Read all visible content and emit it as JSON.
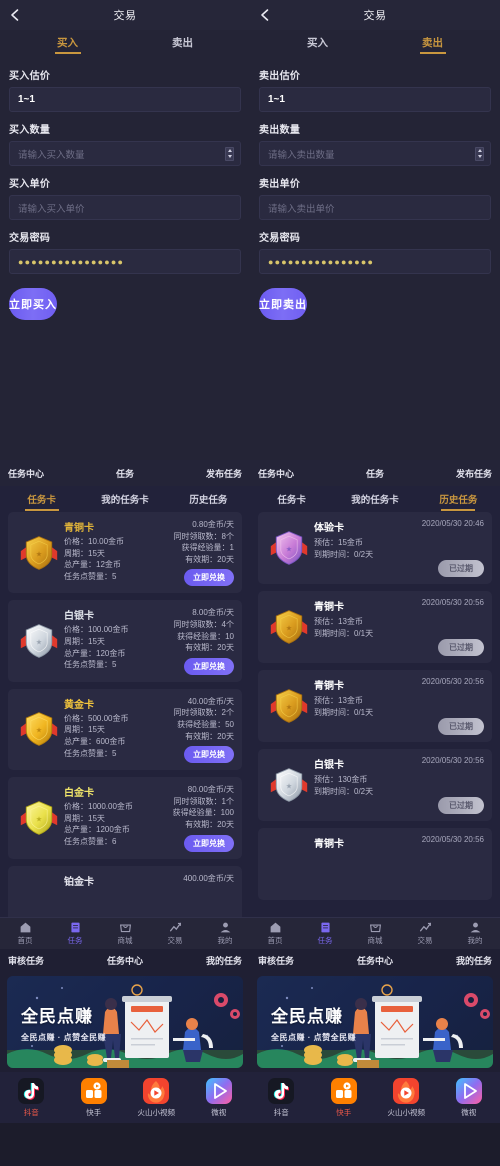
{
  "theme": {
    "bg": "#1c1c2b",
    "panel": "#242436",
    "card": "#2a2a42",
    "accent_gold": "#c9973f",
    "accent_purple": "#6b5bf0",
    "text_primary": "#ffffff",
    "text_secondary": "#b9b9cc",
    "highlight_red": "#f05a4a"
  },
  "trade": {
    "left": {
      "title": "交易",
      "back_icon": "chevron-left-icon",
      "tabs": [
        {
          "label": "买入",
          "active": true
        },
        {
          "label": "卖出",
          "active": false
        }
      ],
      "fields": [
        {
          "label": "买入估价",
          "value": "1~1",
          "placeholder": "",
          "type": "static"
        },
        {
          "label": "买入数量",
          "value": "",
          "placeholder": "请输入买入数量",
          "type": "number"
        },
        {
          "label": "买入单价",
          "value": "",
          "placeholder": "请输入买入单价",
          "type": "text"
        },
        {
          "label": "交易密码",
          "value": "●●●●●●●●●●●●●●●●",
          "placeholder": "",
          "type": "password"
        }
      ],
      "cta": "立即买入"
    },
    "right": {
      "title": "交易",
      "back_icon": "chevron-left-icon",
      "tabs": [
        {
          "label": "买入",
          "active": false
        },
        {
          "label": "卖出",
          "active": true
        }
      ],
      "fields": [
        {
          "label": "卖出估价",
          "value": "1~1",
          "placeholder": "",
          "type": "static"
        },
        {
          "label": "卖出数量",
          "value": "",
          "placeholder": "请输入卖出数量",
          "type": "number"
        },
        {
          "label": "卖出单价",
          "value": "",
          "placeholder": "请输入卖出单价",
          "type": "text"
        },
        {
          "label": "交易密码",
          "value": "●●●●●●●●●●●●●●●●",
          "placeholder": "",
          "type": "password"
        }
      ],
      "cta": "立即卖出"
    }
  },
  "task": {
    "header": {
      "left": "任务中心",
      "mid": "任务",
      "right": "发布任务"
    },
    "left": {
      "tabs": [
        {
          "label": "任务卡",
          "active": true
        },
        {
          "label": "我的任务卡",
          "active": false
        },
        {
          "label": "历史任务",
          "active": false
        }
      ],
      "cards": [
        {
          "name": "青铜卡",
          "color": "#e0b43a",
          "medal": "bronze",
          "left_lines": [
            "价格：10.00金币",
            "周期：15天",
            "总产量：12金币",
            "任务点赞量：5"
          ],
          "right_lines": [
            "0.80金币/天",
            "同时领取数：8个",
            "获得经验量：1",
            "有效期：20天"
          ],
          "button": "立即兑换"
        },
        {
          "name": "白银卡",
          "color": "#dfe3ea",
          "medal": "silver",
          "left_lines": [
            "价格：100.00金币",
            "周期：15天",
            "总产量：120金币",
            "任务点赞量：5"
          ],
          "right_lines": [
            "8.00金币/天",
            "同时领取数：4个",
            "获得经验量：10",
            "有效期：20天"
          ],
          "button": "立即兑换"
        },
        {
          "name": "黄金卡",
          "color": "#f2c53d",
          "medal": "gold",
          "left_lines": [
            "价格：500.00金币",
            "周期：15天",
            "总产量：600金币",
            "任务点赞量：5"
          ],
          "right_lines": [
            "40.00金币/天",
            "同时领取数：2个",
            "获得经验量：50",
            "有效期：20天"
          ],
          "button": "立即兑换"
        },
        {
          "name": "白金卡",
          "color": "#f0e56a",
          "medal": "platinum",
          "left_lines": [
            "价格：1000.00金币",
            "周期：15天",
            "总产量：1200金币",
            "任务点赞量：6"
          ],
          "right_lines": [
            "80.00金币/天",
            "同时领取数：1个",
            "获得经验量：100",
            "有效期：20天"
          ],
          "button": "立即兑换"
        }
      ],
      "partial_card": {
        "name": "铂金卡",
        "right": "400.00金币/天"
      }
    },
    "right": {
      "tabs": [
        {
          "label": "任务卡",
          "active": false
        },
        {
          "label": "我的任务卡",
          "active": false
        },
        {
          "label": "历史任务",
          "active": true
        }
      ],
      "cards": [
        {
          "name": "体验卡",
          "medal": "experience",
          "date": "2020/05/30 20:46",
          "lines": [
            "预估：15金币",
            "到期时间：0/2天"
          ],
          "status": "已过期"
        },
        {
          "name": "青铜卡",
          "medal": "bronze",
          "date": "2020/05/30 20:56",
          "lines": [
            "预估：13金币",
            "到期时间：0/1天"
          ],
          "status": "已过期"
        },
        {
          "name": "青铜卡",
          "medal": "bronze",
          "date": "2020/05/30 20:56",
          "lines": [
            "预估：13金币",
            "到期时间：0/1天"
          ],
          "status": "已过期"
        },
        {
          "name": "白银卡",
          "medal": "silver",
          "date": "2020/05/30 20:56",
          "lines": [
            "预估：130金币",
            "到期时间：0/2天"
          ],
          "status": "已过期"
        }
      ],
      "partial_card": {
        "name": "青铜卡",
        "right": "2020/05/30 20:56"
      }
    }
  },
  "bottom_nav": {
    "items": [
      {
        "label": "首页",
        "icon": "home-icon",
        "active": false
      },
      {
        "label": "任务",
        "icon": "task-list-icon",
        "active": true
      },
      {
        "label": "商城",
        "icon": "shop-bag-icon",
        "active": false
      },
      {
        "label": "交易",
        "icon": "chart-trend-icon",
        "active": false
      },
      {
        "label": "我的",
        "icon": "user-person-icon",
        "active": false
      }
    ]
  },
  "sub_header": {
    "left": "审核任务",
    "mid": "任务中心",
    "right": "我的任务"
  },
  "banner": {
    "title": "全民点赚",
    "subtitle": "全民点赚 · 点赞全民赚"
  },
  "app_row": {
    "left": [
      {
        "label": "抖音",
        "icon": "douyin-icon",
        "active": true
      },
      {
        "label": "快手",
        "icon": "kuaishou-icon",
        "active": false
      },
      {
        "label": "火山小视频",
        "icon": "huoshan-icon",
        "active": false
      },
      {
        "label": "微视",
        "icon": "weishi-icon",
        "active": false
      }
    ],
    "right": [
      {
        "label": "抖音",
        "icon": "douyin-icon",
        "active": false
      },
      {
        "label": "快手",
        "icon": "kuaishou-icon",
        "active": true
      },
      {
        "label": "火山小视频",
        "icon": "huoshan-icon",
        "active": false
      },
      {
        "label": "微视",
        "icon": "weishi-icon",
        "active": false
      }
    ]
  }
}
